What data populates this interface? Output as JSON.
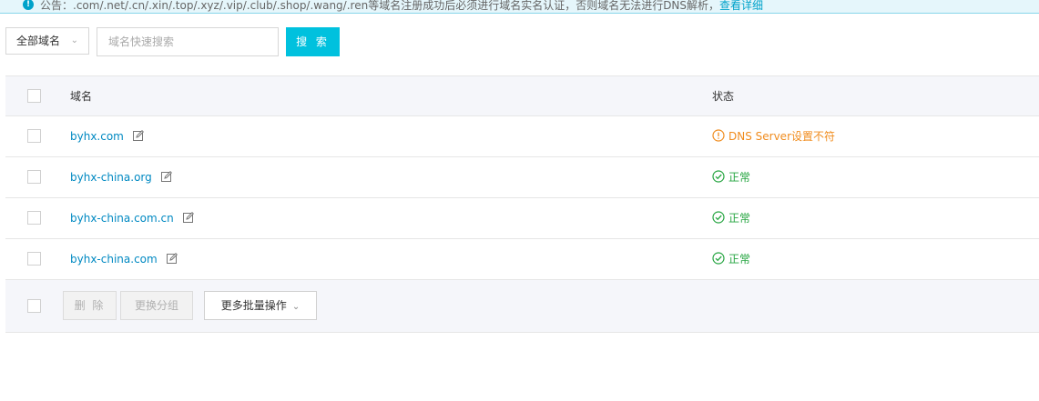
{
  "notice": {
    "text": "公告：.com/.net/.cn/.xin/.top/.xyz/.vip/.club/.shop/.wang/.ren等域名注册成功后必须进行域名实名认证，否则域名无法进行DNS解析，",
    "link": "查看详细"
  },
  "toolbar": {
    "scope_select": "全部域名",
    "search_placeholder": "域名快速搜索",
    "search_button": "搜 索"
  },
  "table": {
    "columns": {
      "domain": "域名",
      "status": "状态"
    },
    "rows": [
      {
        "domain": "byhx.com",
        "status": "DNS Server设置不符",
        "status_type": "warning"
      },
      {
        "domain": "byhx-china.org",
        "status": "正常",
        "status_type": "ok"
      },
      {
        "domain": "byhx-china.com.cn",
        "status": "正常",
        "status_type": "ok"
      },
      {
        "domain": "byhx-china.com",
        "status": "正常",
        "status_type": "ok"
      }
    ]
  },
  "footer": {
    "delete_button": "删 除",
    "change_group_button": "更换分组",
    "more_batch_button": "更多批量操作"
  },
  "colors": {
    "primary": "#00c1de",
    "link": "#0089c2",
    "warning": "#f08c1e",
    "ok": "#26a541"
  },
  "icons": {
    "edit": "edit-icon",
    "warning": "warning-circle-icon",
    "ok": "check-circle-icon",
    "chevron": "chevron-down-icon",
    "info": "info-icon"
  }
}
